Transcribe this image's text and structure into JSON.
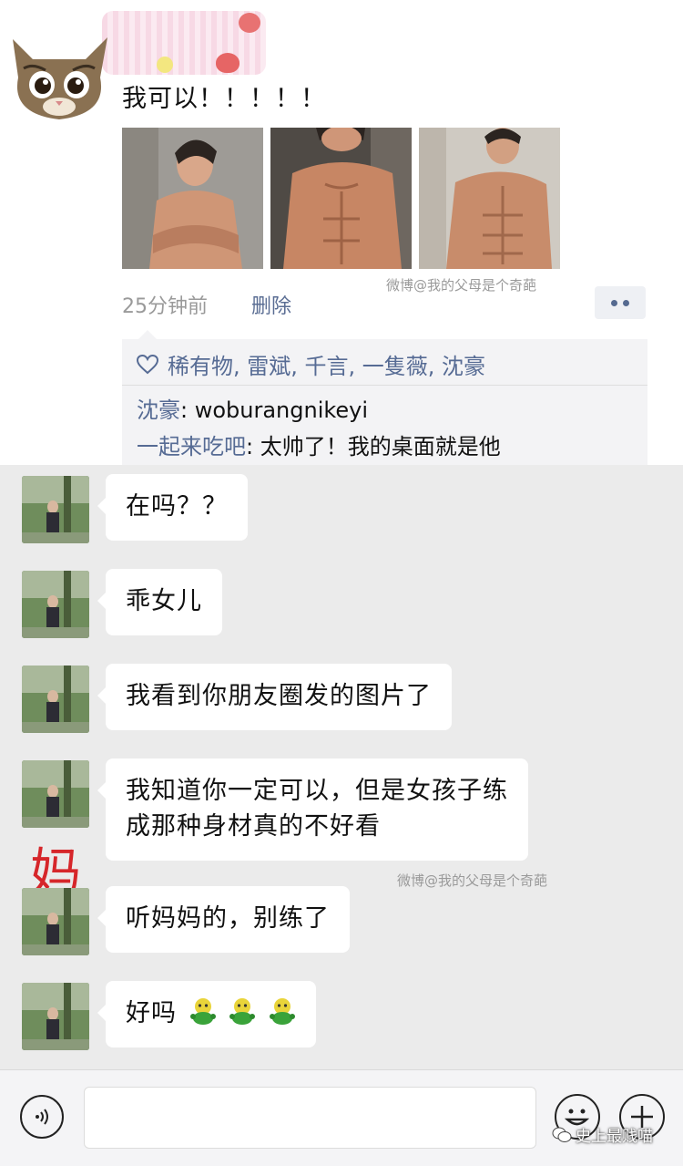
{
  "moment": {
    "post_text": "我可以！！！！！",
    "watermark": "微博@我的父母是个奇葩",
    "time": "25分钟前",
    "delete_label": "删除",
    "likes": "稀有物, 雷斌, 千言, 一隻薇, 沈豪",
    "comments": [
      {
        "author": "沈豪",
        "text": ": woburangnikeyi"
      },
      {
        "author": "一起来吃吧",
        "text": ": 太帅了！我的桌面就是他"
      }
    ]
  },
  "chat": {
    "messages": [
      "在吗？？",
      "乖女儿",
      "我看到你朋友圈发的图片了",
      "我知道你一定可以，但是女孩子练",
      "成那种身材真的不好看",
      "听妈妈的，别练了",
      "好吗"
    ],
    "sender_tag": "妈",
    "watermark": "微博@我的父母是个奇葩"
  },
  "input_bar": {
    "brand": "史上最贱喵",
    "icons": [
      "voice-icon",
      "emoji-icon",
      "plus-icon"
    ]
  }
}
